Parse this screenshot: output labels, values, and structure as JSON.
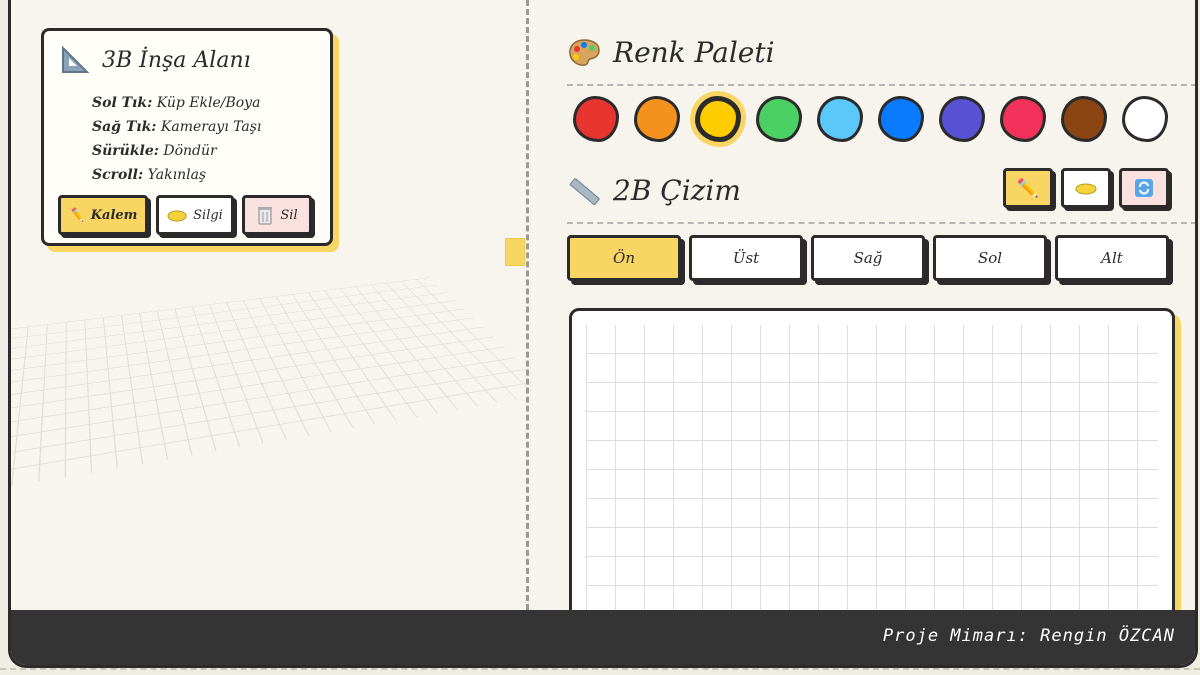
{
  "info_card": {
    "title": "3B İnşa Alanı",
    "instructions": [
      {
        "key": "Sol Tık:",
        "value": " Küp Ekle/Boya"
      },
      {
        "key": "Sağ Tık:",
        "value": " Kamerayı Taşı"
      },
      {
        "key": "Sürükle:",
        "value": " Döndür"
      },
      {
        "key": "Scroll:",
        "value": " Yakınlaş"
      }
    ],
    "buttons": {
      "pen": "Kalem",
      "eraser": "Silgi",
      "delete": "Sil"
    }
  },
  "palette": {
    "title": "Renk Paleti",
    "colors": [
      "#e8352f",
      "#f5921e",
      "#ffcc00",
      "#4bd163",
      "#5ac8fa",
      "#0a7aff",
      "#5a52d5",
      "#f2325a",
      "#8b4513",
      "#ffffff"
    ],
    "selected_index": 2
  },
  "drawing": {
    "title": "2B Çizim",
    "tools": [
      "pencil-icon",
      "eraser-icon",
      "refresh-icon"
    ],
    "tabs": [
      "Ön",
      "Üst",
      "Sağ",
      "Sol",
      "Alt"
    ],
    "active_tab": 0
  },
  "footer": {
    "text": "Proje Mimarı: Rengin ÖZCAN"
  },
  "theme": {
    "accent": "#f9d664",
    "ink": "#2b2b2b",
    "footer_bg": "#343434"
  }
}
